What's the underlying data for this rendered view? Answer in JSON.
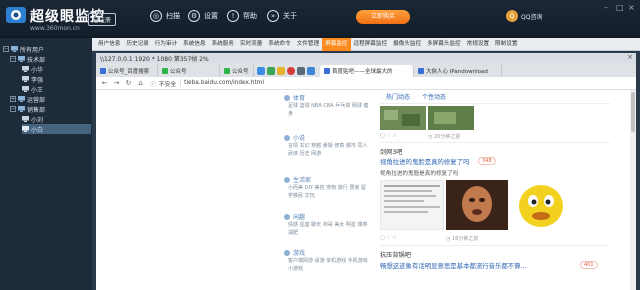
{
  "app": {
    "brand_name": "超级眼监控",
    "brand_url": "www.360mon.cn",
    "edition_badge": "已注册",
    "nav": [
      {
        "label": "扫描",
        "icon": "scan-icon"
      },
      {
        "label": "设置",
        "icon": "gear-icon"
      },
      {
        "label": "帮助",
        "icon": "help-icon"
      },
      {
        "label": "关于",
        "icon": "about-icon"
      }
    ],
    "cta_label": "立即购买",
    "qq_label": "QQ咨询",
    "accent": "#ff8a1e"
  },
  "sidebar": {
    "root": "所有用户",
    "items": [
      {
        "label": "技术部",
        "level": 1
      },
      {
        "label": "小华",
        "level": 2
      },
      {
        "label": "李强",
        "level": 2
      },
      {
        "label": "小王",
        "level": 2
      },
      {
        "label": "运营部",
        "level": 1
      },
      {
        "label": "销售部",
        "level": 1
      },
      {
        "label": "小刘",
        "level": 2
      },
      {
        "label": "小白",
        "level": 2,
        "selected": true
      }
    ]
  },
  "modules": {
    "tabs": [
      "用户信息",
      "历史记录",
      "行为审计",
      "系统信息",
      "系统服务",
      "实时流量",
      "系统命令",
      "文件管理",
      "屏幕监控",
      "远程屏幕监控",
      "摄像头监控",
      "多屏幕头监控",
      "常规设置",
      "限制设置"
    ],
    "active": "屏幕监控"
  },
  "viewer": {
    "title": "\\\\127.0.0.1 1920 * 1080 第357帧 2%",
    "close": "×"
  },
  "browser": {
    "tabs": [
      {
        "label": "公众号_百度搜索",
        "color": "#3b6fd8"
      },
      {
        "label": "公众号",
        "color": "#2db34a"
      },
      {
        "label": "公众号",
        "color": "#2db34a"
      },
      {
        "label": "首度贴吧——全球最大的",
        "color": "#3b6fd8",
        "active": true
      },
      {
        "label": "大侠人心 IPandownload",
        "color": "#3b6fd8"
      }
    ],
    "nav_back": "←",
    "nav_forward": "→",
    "nav_reload": "↻",
    "home": "⌂",
    "security_label": "不安全",
    "url": "tieba.baidu.com/index.html"
  },
  "tieba": {
    "categories": [
      {
        "title": "体育",
        "links": "足球 篮球 NBA CBA 乒乓球 网球 健身"
      },
      {
        "title": "小说",
        "links": "言情 玄幻 穿越 悬疑 修真 都市 同人 武侠 历史 网游"
      },
      {
        "title": "生活家",
        "links": "小而美 DIY 美容 宠物 旅行 居家 留学移民 文玩"
      },
      {
        "title": "闲趣",
        "links": "情感 星座 聊天 帅哥 美女 明星 爆笑 减肥"
      },
      {
        "title": "游戏",
        "links": "客户端网游 桌游 单机游戏 手机游戏 小游戏"
      }
    ],
    "feed_tabs": [
      "热门动态",
      "个性动态"
    ],
    "post1_meta": "20分钟之前",
    "post2_bar": "剑网3吧",
    "post2_title": "视角拉进的鬼脸是真的修复了吗",
    "post2_count": "348",
    "post2_sub": "视角拉进的鬼脸是真的修复了吗",
    "post2_meta": "16分钟之前",
    "post3_bar": "抗压背锅吧",
    "post3_title": "畅想这迹象有话明显意思是基本都流行音乐都不算...",
    "post3_count": "401"
  }
}
